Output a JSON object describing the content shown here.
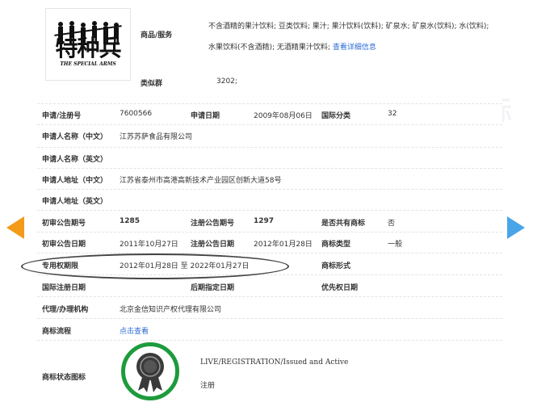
{
  "nav": {
    "prev_color": "#f39a18",
    "next_color": "#4aa5e8"
  },
  "logo": {
    "main_text": "特种兵",
    "sub_text": "THE SPECIAL ARMS"
  },
  "goods": {
    "label": "商品/服务",
    "items_text": "不含酒精的果汁饮料; 豆类饮料; 果汁; 果汁饮料(饮料); 矿泉水; 矿泉水(饮料); 水(饮料); 水果饮料(不含酒精); 无酒精果汁饮料;",
    "detail_link": "查看详细信息"
  },
  "class_group": {
    "label": "类似群",
    "value": "3202;"
  },
  "rows": {
    "app_no_label": "申请/注册号",
    "app_no_value": "7600566",
    "app_date_label": "申请日期",
    "app_date_value": "2009年08月06日",
    "intl_class_label": "国际分类",
    "intl_class_value": "32",
    "applicant_cn_label": "申请人名称（中文）",
    "applicant_cn_value": "江苏苏萨食品有限公司",
    "applicant_en_label": "申请人名称（英文）",
    "address_cn_label": "申请人地址（中文）",
    "address_cn_value": "江苏省泰州市高港高新技术产业园区创新大道58号",
    "address_en_label": "申请人地址（英文）",
    "prelim_no_label": "初审公告期号",
    "prelim_no_value": "1285",
    "reg_no_label": "注册公告期号",
    "reg_no_value": "1297",
    "shared_label": "是否共有商标",
    "shared_value": "否",
    "prelim_date_label": "初审公告日期",
    "prelim_date_value": "2011年10月27日",
    "reg_date_label": "注册公告日期",
    "reg_date_value": "2012年01月28日",
    "tm_type_label": "商标类型",
    "tm_type_value": "一般",
    "exclusive_label": "专用权期限",
    "exclusive_value": "2012年01月28日 至 2022年01月27日",
    "tm_form_label": "商标形式",
    "intl_reg_date_label": "国际注册日期",
    "later_date_label": "后期指定日期",
    "priority_date_label": "优先权日期",
    "agent_label": "代理/办理机构",
    "agent_value": "北京金信知识产权代理有限公司",
    "process_label": "商标流程",
    "process_link": "点击查看",
    "status_label": "商标状态图标",
    "status_en": "LIVE/REGISTRATION/Issued and Active",
    "status_cn": "注册"
  },
  "badge_color": "#1e9b3c",
  "watermarks": [
    "中",
    "国",
    "商",
    "标",
    "中",
    "国",
    "商",
    "标",
    "中",
    "国"
  ]
}
